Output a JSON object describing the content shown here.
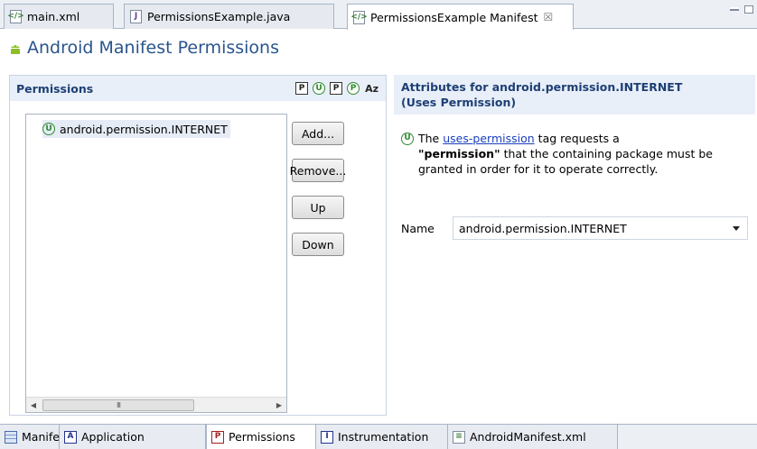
{
  "editor_tabs": [
    {
      "label": "main.xml",
      "icon": "xml-file-icon"
    },
    {
      "label": "PermissionsExample.java",
      "icon": "java-file-icon"
    },
    {
      "label": "PermissionsExample Manifest",
      "icon": "xml-file-icon",
      "active": true,
      "close": "☒"
    }
  ],
  "header": {
    "title": "Android Manifest Permissions",
    "icon": "android-icon"
  },
  "permissions": {
    "title": "Permissions",
    "toolbar": [
      "P",
      "U",
      "P",
      "P",
      "Az"
    ],
    "items": [
      {
        "label": "android.permission.INTERNET",
        "icon_letter": "U"
      }
    ],
    "scroll_thumb": "III",
    "buttons": {
      "add": "Add...",
      "remove": "Remove...",
      "up": "Up",
      "down": "Down"
    }
  },
  "attributes": {
    "title_line1": "Attributes for android.permission.INTERNET",
    "title_line2": "(Uses Permission)",
    "desc_icon_letter": "U",
    "desc_prefix": "The",
    "desc_link": "uses-permission",
    "desc_after_link": "tag requests a",
    "desc_bold": "\"permission\"",
    "desc_rest": "that the containing package must be granted in order for it to operate correctly.",
    "name_label": "Name",
    "name_value": "android.permission.INTERNET"
  },
  "bottom_tabs": [
    {
      "label": "Manifest",
      "icon_letter": ""
    },
    {
      "label": "Application",
      "icon_letter": "A"
    },
    {
      "label": "Permissions",
      "icon_letter": "P",
      "active": true
    },
    {
      "label": "Instrumentation",
      "icon_letter": "I"
    },
    {
      "label": "AndroidManifest.xml",
      "icon_letter": "≡"
    }
  ],
  "colors": {
    "title": "#29558c",
    "section_head_bg": "#e8eff8",
    "section_head_text": "#1e3f74",
    "link": "#1a3fbd",
    "permission_icon": "#2f8a2f"
  }
}
